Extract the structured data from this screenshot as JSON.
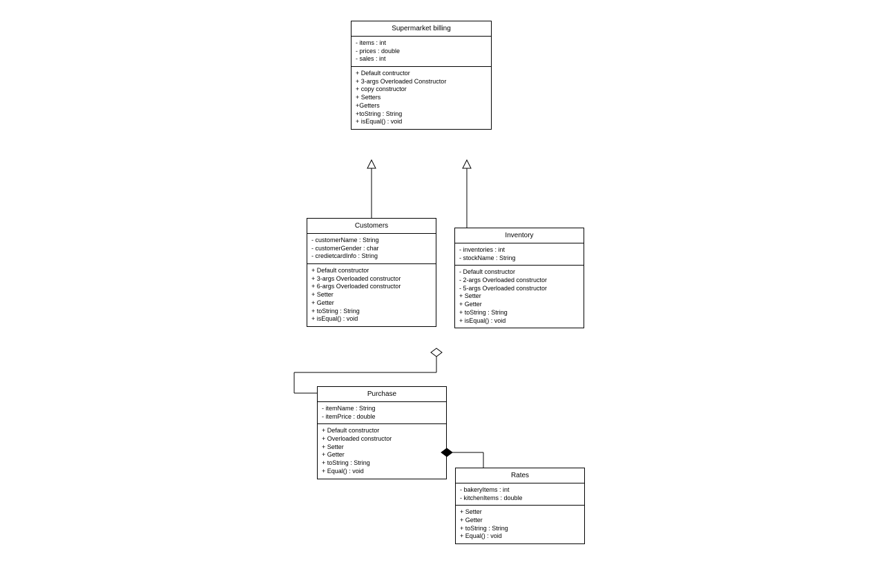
{
  "classes": {
    "supermarket_billing": {
      "title": "Supermarket billing",
      "attrs": [
        "- items : int",
        "- prices : double",
        "- sales : int"
      ],
      "ops": [
        "+ Default contructor",
        "+ 3-args Overloaded Constructor",
        "+ copy constructor",
        "+ Setters",
        "+Getters",
        "+toString : String",
        "+ isEqual() : void"
      ]
    },
    "customers": {
      "title": "Customers",
      "attrs": [
        "- customerName : String",
        "- customerGender : char",
        "- credietcardInfo : String"
      ],
      "ops": [
        "+ Default constructor",
        "+ 3-args Overloaded constructor",
        "+ 6-args Overloaded constructor",
        "+ Setter",
        "+ Getter",
        "+ toString : String",
        "+ isEqual() : void"
      ]
    },
    "inventory": {
      "title": "Inventory",
      "attrs": [
        "- inventories : int",
        "- stockName : String"
      ],
      "ops": [
        "- Default constructor",
        "- 2-args Overloaded constructor",
        "- 5-args Overloaded constructor",
        "+ Setter",
        "+ Getter",
        "+ toString : String",
        "+ isEqual() : void"
      ]
    },
    "purchase": {
      "title": "Purchase",
      "attrs": [
        "- itemName : String",
        "- itemPrice : double"
      ],
      "ops": [
        "+ Default constructor",
        "+ Overloaded constructor",
        "+ Setter",
        "+ Getter",
        "+ toString : String",
        "+ Equal() : void"
      ]
    },
    "rates": {
      "title": "Rates",
      "attrs": [
        "- bakeryItems : int",
        "- kitchenItems : double"
      ],
      "ops": [
        "+ Setter",
        "+ Getter",
        "+ toString : String",
        "+ Equal() : void"
      ]
    }
  }
}
